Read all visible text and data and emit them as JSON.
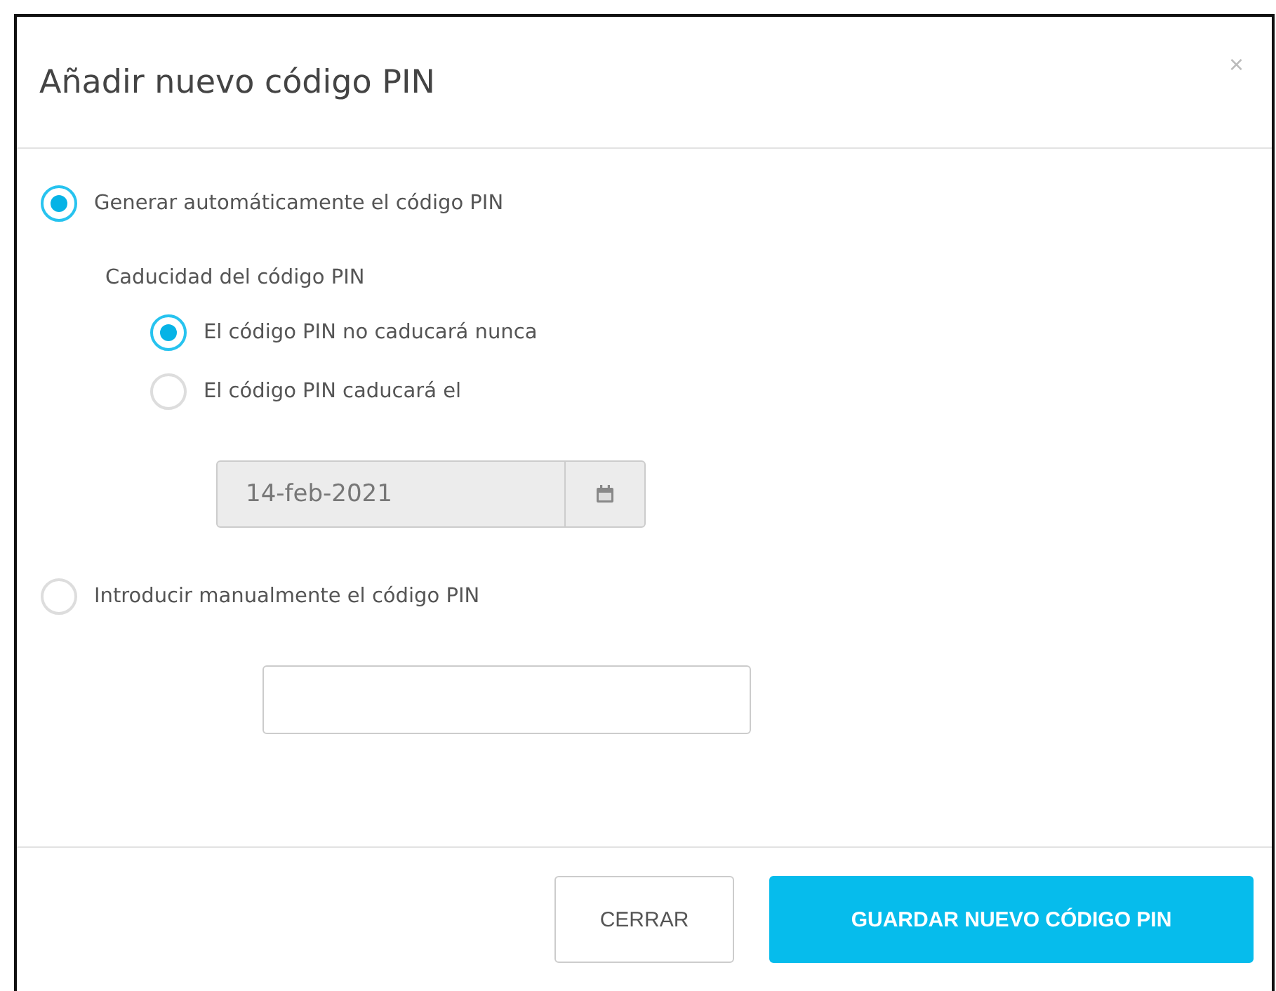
{
  "dialog": {
    "title": "Añadir nuevo código PIN",
    "close": "×"
  },
  "pin_modes": [
    {
      "kind": "auto",
      "label": "Generar automáticamente el código PIN",
      "selected": true,
      "expiry": {
        "label": "Caducidad del código PIN",
        "options": [
          {
            "label": "El código PIN no caducará nunca",
            "selected": true
          },
          {
            "label": "El código PIN caducará el",
            "selected": false
          }
        ],
        "date": {
          "value": "14-feb-2021",
          "disabled": true
        }
      }
    },
    {
      "kind": "manual",
      "label": "Introducir manualmente el código PIN",
      "selected": false
    }
  ],
  "buttons": [
    {
      "kind": "secondary",
      "label": "CERRAR"
    },
    {
      "kind": "primary",
      "label": "GUARDAR NUEVO CÓDIGO PIN"
    }
  ]
}
